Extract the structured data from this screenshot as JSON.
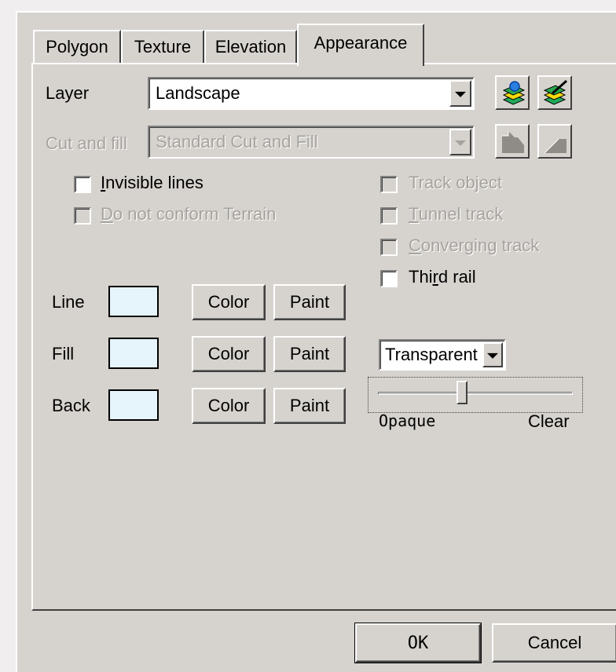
{
  "tabs": [
    {
      "label": "Polygon"
    },
    {
      "label": "Texture"
    },
    {
      "label": "Elevation"
    },
    {
      "label": "Appearance"
    }
  ],
  "active_tab": "Appearance",
  "layer": {
    "label": "Layer",
    "value": "Landscape"
  },
  "cut_and_fill": {
    "label": "Cut and fill",
    "value": "Standard Cut and Fill",
    "enabled": false
  },
  "checkboxes": {
    "invisible_lines": {
      "label": "Invisible lines",
      "checked": false,
      "enabled": true
    },
    "do_not_conform": {
      "label": "Do not conform Terrain",
      "checked": false,
      "enabled": false
    },
    "track_object": {
      "label": "Track object",
      "checked": false,
      "enabled": false
    },
    "tunnel_track": {
      "label": "Tunnel track",
      "checked": false,
      "enabled": false
    },
    "converging_track": {
      "label": "Converging track",
      "checked": false,
      "enabled": false
    },
    "third_rail": {
      "label": "Third rail",
      "checked": false,
      "enabled": true
    }
  },
  "colors": {
    "swatch_color": "#e6f5fb",
    "rows": [
      {
        "label": "Line",
        "color_btn": "Color",
        "paint_btn": "Paint"
      },
      {
        "label": "Fill",
        "color_btn": "Color",
        "paint_btn": "Paint"
      },
      {
        "label": "Back",
        "color_btn": "Color",
        "paint_btn": "Paint"
      }
    ]
  },
  "transparency": {
    "mode": "Transparent",
    "slider_min_label": "Opaque",
    "slider_max_label": "Clear",
    "level": 0.43
  },
  "icons": {
    "top_left": "layer-add-icon",
    "top_right": "layer-edit-icon",
    "bottom_left": "cut-fill-icon",
    "bottom_right": "slope-icon"
  },
  "footer": {
    "ok": "OK",
    "cancel": "Cancel"
  }
}
